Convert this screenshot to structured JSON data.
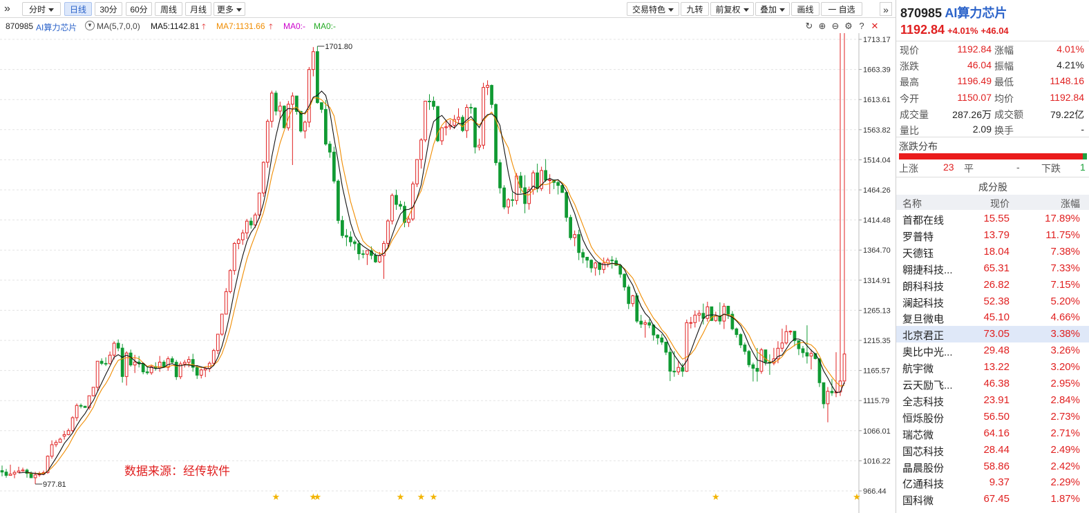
{
  "toolbar": {
    "left_buttons": [
      {
        "label": "分时",
        "caret": true
      },
      {
        "label": "日线",
        "active": true
      },
      {
        "label": "30分"
      },
      {
        "label": "60分"
      },
      {
        "label": "周线"
      },
      {
        "label": "月线"
      },
      {
        "label": "更多",
        "caret": true
      }
    ],
    "right_buttons": [
      {
        "label": "交易特色",
        "caret": true
      },
      {
        "label": "九转"
      },
      {
        "label": "前复权",
        "caret": true
      },
      {
        "label": "叠加",
        "caret": true
      },
      {
        "label": "画线"
      },
      {
        "label": "一 自选"
      }
    ]
  },
  "ma_line": {
    "code": "870985",
    "name": "AI算力芯片",
    "ma_label": "MA(5,7,0,0)",
    "ma5": "MA5:1142.81",
    "ma7": "MA7:1131.66",
    "ma0a": "MA0:-",
    "ma0b": "MA0:-"
  },
  "colors": {
    "up": "#e02020",
    "down": "#109a33",
    "ma5": "#111111",
    "ma7": "#f08c00",
    "ma0a": "#cc00cc",
    "ma0b": "#22aa22",
    "grid": "#e3e3e3",
    "star": "#f2b400",
    "accent": "#2a62c9"
  },
  "chart_data": {
    "type": "candlestick",
    "title": "870985 AI算力芯片",
    "ylim": [
      930,
      1735
    ],
    "y_ticks": [
      1713.17,
      1663.39,
      1613.61,
      1563.82,
      1514.04,
      1464.26,
      1414.48,
      1364.7,
      1314.91,
      1265.13,
      1215.35,
      1165.57,
      1115.79,
      1066.01,
      1016.22,
      966.44
    ],
    "high_label": "1701.80",
    "low_label": "977.81",
    "watermark": "数据来源：经传软件",
    "star_days": [
      66,
      75,
      76,
      96,
      101,
      104,
      172,
      206
    ],
    "series": [
      {
        "name": "OHLC",
        "open": [
          1000.0,
          997.6,
          992.1,
          994.2,
          997.1,
          999.4,
          1000.9,
          995.4,
          988.2,
          992.9,
          994.1,
          996.8,
          1023.8,
          1042.9,
          1046.7,
          1057.0,
          1059.6,
          1066.1,
          1087.5,
          1107.8,
          1106.5,
          1104.3,
          1123.8,
          1137.8,
          1180.9,
          1177.3,
          1176.8,
          1191.0,
          1210.7,
          1202.6,
          1155.6,
          1194.5,
          1174.7,
          1179.6,
          1176.9,
          1163.3,
          1161.8,
          1171.9,
          1169.8,
          1179.4,
          1170.8,
          1185.0,
          1179.2,
          1155.2,
          1176.3,
          1179.0,
          1183.8,
          1170.8,
          1157.8,
          1166.5,
          1168.8,
          1177.5,
          1198.6,
          1225.6,
          1258.8,
          1296.0,
          1330.9,
          1375.7,
          1381.7,
          1393.1,
          1412.6,
          1406.2,
          1422.8,
          1459.1,
          1509.9,
          1577.6,
          1624.3,
          1594.5,
          1602.8,
          1566.9,
          1605.9,
          1619.5,
          1594.0,
          1561.6,
          1576.3,
          1663.3,
          1692.9,
          1608.5,
          1597.4,
          1540.0,
          1526.7,
          1478.8,
          1413.6,
          1388.7,
          1386.4,
          1378.3,
          1375.3,
          1358.6,
          1357.8,
          1363.8,
          1355.9,
          1345.1,
          1355.5,
          1375.8,
          1412.9,
          1455.2,
          1440.2,
          1437.2,
          1410.4,
          1416.1,
          1474.1,
          1514.4,
          1546.8,
          1611.0,
          1610.9,
          1602.3,
          1545.4,
          1567.1,
          1568.5,
          1571.1,
          1580.7,
          1584.3,
          1562.3,
          1600.7,
          1599.7,
          1535.1,
          1538.2,
          1633.7,
          1637.1,
          1605.5,
          1509.2,
          1467.5,
          1435.9,
          1448.0,
          1446.8,
          1487.1,
          1467.8,
          1441.6,
          1464.6,
          1492.4,
          1466.5,
          1496.3,
          1480.4,
          1480.7,
          1476.6,
          1471.6,
          1459.9,
          1418.7,
          1385.2,
          1390.4,
          1360.6,
          1352.9,
          1348.0,
          1335.2,
          1343.4,
          1332.6,
          1343.2,
          1348.2,
          1347.0,
          1339.5,
          1324.9,
          1303.6,
          1276.2,
          1289.2,
          1247.2,
          1242.2,
          1244.6,
          1240.6,
          1224.3,
          1219.5,
          1212.5,
          1195.8,
          1164.4,
          1163.2,
          1170.6,
          1164.3,
          1244.7,
          1244.8,
          1257.2,
          1260.1,
          1251.7,
          1270.9,
          1248.2,
          1255.8,
          1247.3,
          1271.9,
          1258.6,
          1234.4,
          1225.0,
          1207.8,
          1197.2,
          1175.0,
          1169.2,
          1164.2,
          1199.7,
          1179.4,
          1177.8,
          1184.8,
          1202.4,
          1211.1,
          1229.9,
          1230.5,
          1214.9,
          1201.6,
          1195.0,
          1189.4,
          1193.7,
          1185.2,
          1145.4,
          1110.5,
          1131.2,
          1128.6,
          1130.1,
          1148.2
        ],
        "high": [
          1008.4,
          1002.8,
          1009.8,
          1000.5,
          1006.4,
          1004.9,
          1003.3,
          998.7,
          998.0,
          998.4,
          1000.1,
          1025.2,
          1050.0,
          1050.5,
          1054.5,
          1065.8,
          1069.6,
          1090.1,
          1111.0,
          1110.9,
          1107.3,
          1123.7,
          1137.2,
          1180.2,
          1185.7,
          1187.3,
          1196.9,
          1213.9,
          1216.9,
          1209.6,
          1197.3,
          1200.1,
          1191.5,
          1189.5,
          1178.1,
          1172.1,
          1173.8,
          1179.2,
          1189.6,
          1182.8,
          1188.8,
          1188.9,
          1183.0,
          1180.4,
          1183.0,
          1189.1,
          1193.2,
          1174.4,
          1168.4,
          1171.1,
          1180.5,
          1201.5,
          1226.0,
          1258.1,
          1301.8,
          1333.3,
          1378.0,
          1384.3,
          1398.4,
          1416.3,
          1418.4,
          1426.6,
          1459.2,
          1511.3,
          1581.0,
          1628.3,
          1628.3,
          1610.1,
          1604.0,
          1611.3,
          1625.5,
          1620.0,
          1595.0,
          1578.7,
          1667.4,
          1700.4,
          1701.8,
          1608.9,
          1612.8,
          1544.9,
          1535.7,
          1481.6,
          1421.2,
          1399.5,
          1395.6,
          1381.7,
          1381.1,
          1364.8,
          1364.3,
          1370.8,
          1359.9,
          1361.6,
          1379.9,
          1415.8,
          1458.3,
          1464.7,
          1446.2,
          1444.7,
          1421.1,
          1478.1,
          1514.5,
          1549.6,
          1611.6,
          1622.5,
          1618.6,
          1602.7,
          1567.6,
          1578.0,
          1579.9,
          1588.1,
          1599.2,
          1588.0,
          1605.6,
          1607.0,
          1600.8,
          1548.9,
          1641.4,
          1645.4,
          1638.4,
          1607.3,
          1514.8,
          1472.0,
          1450.7,
          1460.2,
          1492.2,
          1493.8,
          1488.6,
          1469.6,
          1496.5,
          1507.6,
          1502.6,
          1515.2,
          1490.2,
          1481.1,
          1479.3,
          1474.1,
          1461.8,
          1423.2,
          1397.1,
          1398.3,
          1366.7,
          1353.2,
          1349.3,
          1345.7,
          1345.0,
          1352.4,
          1352.0,
          1354.8,
          1352.1,
          1342.0,
          1325.9,
          1307.5,
          1290.7,
          1293.7,
          1257.6,
          1248.9,
          1250.4,
          1242.5,
          1225.6,
          1225.7,
          1212.9,
          1202.8,
          1197.5,
          1182.0,
          1177.3,
          1249.8,
          1254.2,
          1264.9,
          1265.6,
          1276.2,
          1279.3,
          1271.2,
          1262.8,
          1278.3,
          1276.8,
          1272.6,
          1263.8,
          1236.6,
          1227.4,
          1211.8,
          1199.6,
          1178.5,
          1202.8,
          1202.9,
          1181.4,
          1192.2,
          1203.0,
          1214.0,
          1234.8,
          1240.7,
          1231.9,
          1221.5,
          1202.8,
          1206.2,
          1240.3,
          1200.3,
          1187.4,
          1148.7,
          1141.9,
          1138.2,
          1151.8,
          1195.8
        ],
        "low": [
          990.6,
          988.3,
          992.3,
          987.4,
          996.9,
          998.2,
          988.3,
          987.6,
          977.8,
          989.8,
          992.4,
          994.7,
          1019.7,
          1038.9,
          1046.7,
          1051.3,
          1058.3,
          1063.5,
          1082.0,
          1102.9,
          1104.6,
          1100.7,
          1122.5,
          1131.1,
          1174.4,
          1172.9,
          1175.7,
          1183.9,
          1197.4,
          1145.5,
          1140.7,
          1171.9,
          1161.4,
          1170.6,
          1159.3,
          1158.7,
          1158.5,
          1165.2,
          1163.4,
          1170.7,
          1165.0,
          1177.7,
          1150.0,
          1151.3,
          1170.6,
          1171.0,
          1163.5,
          1151.6,
          1152.4,
          1154.7,
          1163.1,
          1173.7,
          1192.6,
          1222.8,
          1258.8,
          1293.0,
          1323.9,
          1366.1,
          1373.4,
          1383.2,
          1400.0,
          1401.2,
          1416.6,
          1452.7,
          1500.9,
          1567.3,
          1587.4,
          1580.5,
          1566.1,
          1562.2,
          1505.4,
          1588.6,
          1559.1,
          1549.4,
          1567.8,
          1652.0,
          1606.8,
          1591.5,
          1537.4,
          1517.3,
          1474.9,
          1408.4,
          1384.3,
          1371.2,
          1370.6,
          1364.3,
          1348.2,
          1351.1,
          1340.0,
          1349.4,
          1343.6,
          1343.3,
          1317.1,
          1369.1,
          1407.1,
          1431.2,
          1431.5,
          1402.4,
          1402.9,
          1412.8,
          1468.9,
          1499.5,
          1543.2,
          1596.5,
          1596.5,
          1543.4,
          1538.5,
          1554.3,
          1563.9,
          1565.0,
          1575.1,
          1559.8,
          1550.2,
          1590.3,
          1524.5,
          1529.5,
          1531.8,
          1621.1,
          1599.3,
          1504.6,
          1458.2,
          1432.1,
          1424.5,
          1436.7,
          1439.9,
          1458.8,
          1425.6,
          1431.5,
          1456.4,
          1460.1,
          1462.4,
          1477.4,
          1457.5,
          1465.5,
          1456.7,
          1470.2,
          1411.6,
          1381.5,
          1371.1,
          1348.1,
          1342.8,
          1335.5,
          1327.6,
          1322.3,
          1323.4,
          1326.2,
          1336.2,
          1334.1,
          1338.5,
          1318.9,
          1297.7,
          1267.1,
          1271.0,
          1244.1,
          1235.9,
          1219.8,
          1235.5,
          1214.8,
          1208.6,
          1208.0,
          1191.1,
          1148.1,
          1155.2,
          1158.3,
          1155.2,
          1163.1,
          1235.1,
          1236.7,
          1246.3,
          1241.6,
          1246.3,
          1247.3,
          1245.9,
          1241.4,
          1234.2,
          1250.9,
          1232.0,
          1220.0,
          1202.6,
          1191.8,
          1170.9,
          1147.4,
          1147.3,
          1160.1,
          1173.8,
          1158.4,
          1174.3,
          1177.6,
          1196.4,
          1208.3,
          1224.5,
          1205.7,
          1191.0,
          1187.0,
          1177.1,
          1167.3,
          1183.8,
          1138.3,
          1102.9,
          1079.9,
          1123.6,
          1121.4,
          1123.5,
          1142.8
        ],
        "close": [
          997.6,
          992.1,
          994.2,
          997.1,
          999.4,
          1000.9,
          995.4,
          988.2,
          992.9,
          994.1,
          996.8,
          1023.8,
          1042.9,
          1046.7,
          1052.0,
          1059.6,
          1066.1,
          1087.5,
          1107.8,
          1106.5,
          1104.3,
          1123.8,
          1137.8,
          1180.9,
          1177.3,
          1176.8,
          1191.0,
          1210.7,
          1202.6,
          1155.6,
          1194.5,
          1174.7,
          1179.6,
          1176.9,
          1163.3,
          1161.8,
          1171.9,
          1169.8,
          1179.4,
          1170.8,
          1185.0,
          1179.2,
          1155.2,
          1176.3,
          1179.0,
          1183.8,
          1170.8,
          1157.8,
          1166.5,
          1168.8,
          1177.5,
          1198.6,
          1225.6,
          1258.8,
          1296.0,
          1330.9,
          1375.7,
          1381.7,
          1393.1,
          1412.6,
          1406.2,
          1422.8,
          1459.1,
          1509.9,
          1577.6,
          1624.3,
          1594.5,
          1602.8,
          1566.9,
          1605.9,
          1619.5,
          1594.0,
          1561.6,
          1576.3,
          1663.3,
          1692.9,
          1608.5,
          1597.4,
          1540.0,
          1526.7,
          1478.8,
          1413.6,
          1388.7,
          1386.4,
          1378.3,
          1375.3,
          1358.6,
          1357.8,
          1363.8,
          1355.9,
          1345.1,
          1355.5,
          1375.8,
          1412.9,
          1455.2,
          1440.2,
          1437.2,
          1410.4,
          1416.1,
          1474.1,
          1514.4,
          1546.8,
          1611.0,
          1610.9,
          1602.3,
          1545.4,
          1567.1,
          1568.5,
          1571.1,
          1580.7,
          1584.3,
          1562.3,
          1600.7,
          1599.7,
          1535.1,
          1538.2,
          1633.7,
          1637.1,
          1605.5,
          1509.2,
          1467.5,
          1435.9,
          1448.0,
          1446.8,
          1487.1,
          1467.8,
          1441.6,
          1464.6,
          1492.4,
          1466.5,
          1496.3,
          1480.4,
          1480.7,
          1476.6,
          1471.6,
          1459.9,
          1418.7,
          1385.2,
          1390.4,
          1360.6,
          1352.9,
          1348.0,
          1335.2,
          1343.4,
          1332.6,
          1343.2,
          1348.2,
          1347.0,
          1339.5,
          1324.9,
          1303.6,
          1276.2,
          1289.2,
          1247.2,
          1242.2,
          1244.6,
          1240.6,
          1224.3,
          1219.5,
          1212.5,
          1195.8,
          1164.4,
          1163.2,
          1170.6,
          1164.3,
          1244.7,
          1244.8,
          1257.2,
          1260.1,
          1251.7,
          1270.9,
          1248.2,
          1255.8,
          1247.3,
          1271.9,
          1258.6,
          1234.4,
          1225.0,
          1207.8,
          1197.2,
          1175.0,
          1169.2,
          1164.2,
          1199.7,
          1179.4,
          1177.8,
          1184.8,
          1202.4,
          1211.1,
          1229.9,
          1230.5,
          1214.9,
          1201.6,
          1195.0,
          1189.4,
          1193.7,
          1185.2,
          1145.4,
          1110.5,
          1131.2,
          1128.6,
          1130.1,
          1148.2,
          1192.8
        ]
      }
    ]
  },
  "panel": {
    "code": "870985",
    "name": "AI算力芯片",
    "price": "1192.84",
    "pct": "+4.01%",
    "chg": "+46.04",
    "quotes": [
      {
        "l1": "现价",
        "v1": "1192.84",
        "c1": "red",
        "l2": "涨幅",
        "v2": "4.01%",
        "c2": "red"
      },
      {
        "l1": "涨跌",
        "v1": "46.04",
        "c1": "red",
        "l2": "振幅",
        "v2": "4.21%",
        "c2": "blk"
      },
      {
        "l1": "最高",
        "v1": "1196.49",
        "c1": "red",
        "l2": "最低",
        "v2": "1148.16",
        "c2": "red"
      },
      {
        "l1": "今开",
        "v1": "1150.07",
        "c1": "red",
        "l2": "均价",
        "v2": "1192.84",
        "c2": "red"
      },
      {
        "l1": "成交量",
        "v1": "287.26万",
        "c1": "blk",
        "l2": "成交额",
        "v2": "79.22亿",
        "c2": "blk"
      },
      {
        "l1": "量比",
        "v1": "2.09",
        "c1": "blk",
        "l2": "换手",
        "v2": "-",
        "c2": "blk"
      }
    ],
    "dist_title": "涨跌分布",
    "dist": {
      "up_label": "上涨",
      "up": "23",
      "flat_label": "平",
      "flat": "-",
      "down_label": "下跌",
      "down": "1"
    },
    "comp_title": "成分股",
    "comp_head": {
      "name": "名称",
      "price": "现价",
      "pct": "涨幅"
    },
    "components": [
      {
        "name": "首都在线",
        "price": "15.55",
        "pct": "17.89%"
      },
      {
        "name": "罗普特",
        "price": "13.79",
        "pct": "11.75%"
      },
      {
        "name": "天德钰",
        "price": "18.04",
        "pct": "7.38%"
      },
      {
        "name": "翱捷科技...",
        "price": "65.31",
        "pct": "7.33%"
      },
      {
        "name": "朗科科技",
        "price": "26.82",
        "pct": "7.15%"
      },
      {
        "name": "澜起科技",
        "price": "52.38",
        "pct": "5.20%"
      },
      {
        "name": "复旦微电",
        "price": "45.10",
        "pct": "4.66%"
      },
      {
        "name": "北京君正",
        "price": "73.05",
        "pct": "3.38%",
        "selected": true
      },
      {
        "name": "奥比中光...",
        "price": "29.48",
        "pct": "3.26%"
      },
      {
        "name": "航宇微",
        "price": "13.22",
        "pct": "3.20%"
      },
      {
        "name": "云天励飞...",
        "price": "46.38",
        "pct": "2.95%"
      },
      {
        "name": "全志科技",
        "price": "23.91",
        "pct": "2.84%"
      },
      {
        "name": "恒烁股份",
        "price": "56.50",
        "pct": "2.73%"
      },
      {
        "name": "瑞芯微",
        "price": "64.16",
        "pct": "2.71%"
      },
      {
        "name": "国芯科技",
        "price": "28.44",
        "pct": "2.49%"
      },
      {
        "name": "晶晨股份",
        "price": "58.86",
        "pct": "2.42%"
      },
      {
        "name": "亿通科技",
        "price": "9.37",
        "pct": "2.29%"
      },
      {
        "name": "国科微",
        "price": "67.45",
        "pct": "1.87%"
      }
    ]
  }
}
